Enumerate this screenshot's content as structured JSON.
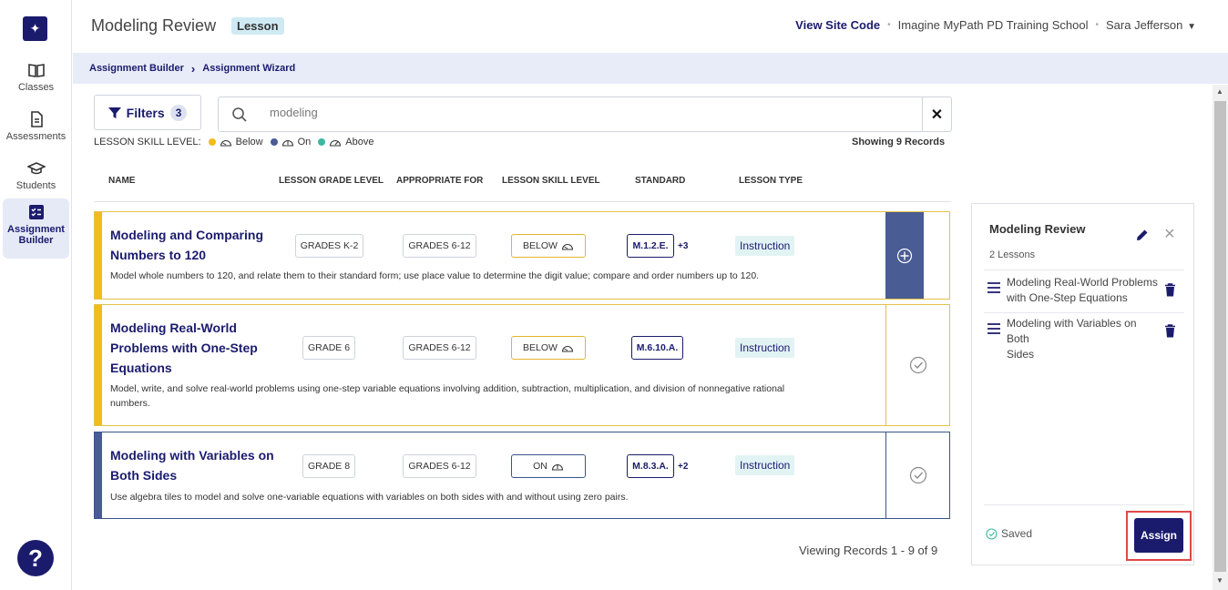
{
  "nav": {
    "items": [
      {
        "label": "Classes",
        "icon": "book-icon"
      },
      {
        "label": "Assessments",
        "icon": "document-icon"
      },
      {
        "label": "Students",
        "icon": "graduation-cap-icon"
      },
      {
        "label": "Assignment Builder",
        "icon": "checklist-icon"
      }
    ],
    "help_label": "?"
  },
  "header": {
    "title": "Modeling Review",
    "badge": "Lesson",
    "view_site_code": "View Site Code",
    "school": "Imagine MyPath PD Training School",
    "user": "Sara  Jefferson",
    "separator": "•"
  },
  "breadcrumb": {
    "items": [
      "Assignment Builder",
      "Assignment Wizard"
    ]
  },
  "filters": {
    "label": "Filters",
    "count": "3"
  },
  "search": {
    "value": "modeling",
    "clear": "✕"
  },
  "legend": {
    "label": "LESSON SKILL LEVEL:",
    "below": "Below",
    "on": "On",
    "above": "Above",
    "colors": {
      "below": "#f3bc1c",
      "on": "#4a5c94",
      "above": "#3cb8a0"
    }
  },
  "records_label": "Showing 9 Records",
  "columns": {
    "name": "NAME",
    "grade": "LESSON GRADE LEVEL",
    "appropriate": "APPROPRIATE FOR",
    "skill": "LESSON SKILL LEVEL",
    "standard": "STANDARD",
    "type": "LESSON TYPE"
  },
  "rows": [
    {
      "name_line1": "Modeling and Comparing",
      "name_line2": "Numbers to 120",
      "name_line3": "",
      "description": "Model whole numbers to 120, and relate them to their standard form; use place value to determine the digit value; compare and order numbers up to 120.",
      "grade": "GRADES K-2",
      "appropriate": "GRADES 6-12",
      "skill": "BELOW",
      "standard": "M.1.2.E.",
      "standard_extra": "+3",
      "type": "Instruction",
      "status": "add"
    },
    {
      "name_line1": "Modeling Real-World",
      "name_line2": "Problems with One-Step",
      "name_line3": "Equations",
      "description_line1": "Model, write, and solve real-world problems using one-step variable equations involving addition, subtraction, multiplication, and division of nonnegative rational",
      "description_line2": "numbers.",
      "grade": "GRADE 6",
      "appropriate": "GRADES 6-12",
      "skill": "BELOW",
      "standard": "M.6.10.A.",
      "standard_extra": "",
      "type": "Instruction",
      "status": "added"
    },
    {
      "name_line1": "Modeling with Variables on",
      "name_line2": "Both Sides",
      "name_line3": "",
      "description": "Use algebra tiles to model and solve one-variable equations with variables on both sides with and without using zero pairs.",
      "grade": "GRADE 8",
      "appropriate": "GRADES 6-12",
      "skill": "ON",
      "standard": "M.8.3.A.",
      "standard_extra": "+2",
      "type": "Instruction",
      "status": "added"
    }
  ],
  "viewing": "Viewing Records 1 - 9 of 9",
  "panel": {
    "title": "Modeling Review",
    "count": "2 Lessons",
    "lessons": [
      {
        "line1": "Modeling Real-World Problems",
        "line2": "with One-Step Equations"
      },
      {
        "line1": "Modeling with Variables on Both",
        "line2": "Sides"
      }
    ],
    "saved": "Saved",
    "assign": "Assign"
  }
}
